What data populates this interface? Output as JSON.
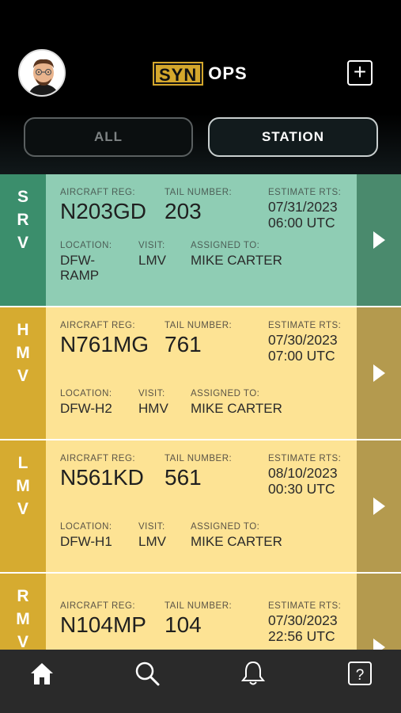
{
  "header": {
    "logo_highlight": "SYN",
    "logo_rest": "OPS",
    "avatar_icon": "user-avatar",
    "add_icon": "plus-square-icon"
  },
  "filters": {
    "all_label": "ALL",
    "station_label": "STATION",
    "selected": "STATION"
  },
  "labels": {
    "reg": "AIRCRAFT REG:",
    "tail": "TAIL NUMBER:",
    "rts": "ESTIMATE RTS:",
    "location": "LOCATION:",
    "visit": "VISIT:",
    "assigned": "ASSIGNED TO:"
  },
  "cards": [
    {
      "code": [
        "S",
        "R",
        "V"
      ],
      "reg": "N203GD",
      "tail": "203",
      "rts_date": "07/31/2023",
      "rts_time": "06:00 UTC",
      "location_l1": "DFW-",
      "location_l2": "RAMP",
      "visit": "LMV",
      "assigned": "MIKE CARTER",
      "color": "#8fcdb4"
    },
    {
      "code": [
        "H",
        "M",
        "V"
      ],
      "reg": "N761MG",
      "tail": "761",
      "rts_date": "07/30/2023",
      "rts_time": "07:00 UTC",
      "location_l1": "DFW-H2",
      "location_l2": "",
      "visit": "HMV",
      "assigned": "MIKE CARTER",
      "color": "#fde394"
    },
    {
      "code": [
        "L",
        "M",
        "V"
      ],
      "reg": "N561KD",
      "tail": "561",
      "rts_date": "08/10/2023",
      "rts_time": "00:30 UTC",
      "location_l1": "DFW-H1",
      "location_l2": "",
      "visit": "LMV",
      "assigned": "MIKE CARTER",
      "color": "#fde394"
    },
    {
      "code": [
        "R",
        "M",
        "V"
      ],
      "reg": "N104MP",
      "tail": "104",
      "rts_date": "07/30/2023",
      "rts_time": "22:56 UTC",
      "location_l1": "",
      "location_l2": "",
      "visit": "",
      "assigned": "",
      "color": "#fde394"
    }
  ],
  "tabbar": {
    "icons": [
      "home-icon",
      "search-icon",
      "bell-icon",
      "help-icon"
    ],
    "help_glyph": "?"
  }
}
